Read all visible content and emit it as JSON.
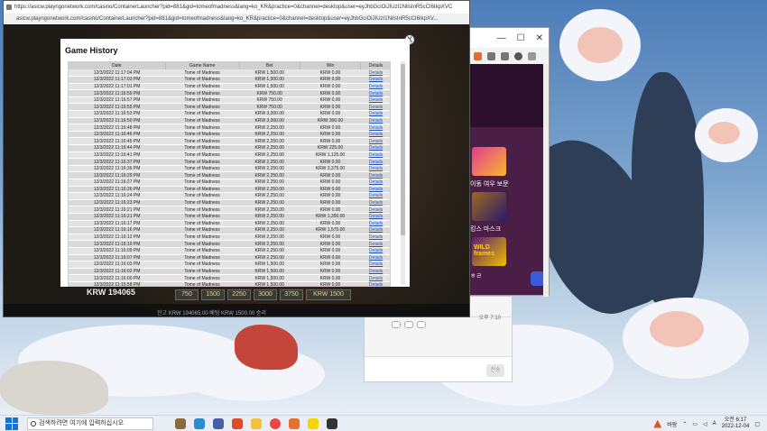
{
  "game_window": {
    "title": "https://asicw.playngonetwork.com/casino/ContainerLauncher?pid=881&gid=tomeofmadness&lang=ko_KR&practice=0&channel=desktop&user=eyJhbGciOiJIUzI1NiIsInR5cCI6IkpXVC",
    "url": "asicw.playngonetwork.com/casino/ContainerLauncher?pid=881&gid=tomeofmadness&lang=ko_KR&practice=0&channel=desktop&user=eyJhbGciOiJIUzI1NiIsInR5cCI6IkpXV...",
    "balance": "KRW 194065",
    "bet_options": [
      "750",
      "1500",
      "2250",
      "3000",
      "3750"
    ],
    "bet_display": "KRW 1500",
    "info_line": "잔고  KRW 194065.00     베팅  KRW 1500.00     승리",
    "close_symbol": "X"
  },
  "modal": {
    "title": "Game History",
    "columns": [
      "Date",
      "Game Name",
      "Bet",
      "Win",
      "Details"
    ],
    "rows": [
      [
        "12/3/2022 11:17:04 PM",
        "Tome of Madness",
        "KRW 1,500.00",
        "KRW 0.00",
        "Details"
      ],
      [
        "12/3/2022 11:17:03 PM",
        "Tome of Madness",
        "KRW 1,500.00",
        "KRW 0.00",
        "Details"
      ],
      [
        "12/3/2022 11:17:01 PM",
        "Tome of Madness",
        "KRW 1,500.00",
        "KRW 0.00",
        "Details"
      ],
      [
        "12/3/2022 11:16:59 PM",
        "Tome of Madness",
        "KRW 750.00",
        "KRW 0.00",
        "Details"
      ],
      [
        "12/3/2022 11:16:57 PM",
        "Tome of Madness",
        "KRW 750.00",
        "KRW 0.00",
        "Details"
      ],
      [
        "12/3/2022 11:16:55 PM",
        "Tome of Madness",
        "KRW 750.00",
        "KRW 0.00",
        "Details"
      ],
      [
        "12/3/2022 11:16:53 PM",
        "Tome of Madness",
        "KRW 3,000.00",
        "KRW 0.00",
        "Details"
      ],
      [
        "12/3/2022 11:16:50 PM",
        "Tome of Madness",
        "KRW 3,000.00",
        "KRW 300.00",
        "Details"
      ],
      [
        "12/3/2022 11:16:48 PM",
        "Tome of Madness",
        "KRW 2,250.00",
        "KRW 0.00",
        "Details"
      ],
      [
        "12/3/2022 11:16:46 PM",
        "Tome of Madness",
        "KRW 2,250.00",
        "KRW 0.00",
        "Details"
      ],
      [
        "12/3/2022 11:16:45 PM",
        "Tome of Madness",
        "KRW 2,250.00",
        "KRW 0.00",
        "Details"
      ],
      [
        "12/3/2022 11:16:44 PM",
        "Tome of Madness",
        "KRW 2,250.00",
        "KRW 225.00",
        "Details"
      ],
      [
        "12/3/2022 11:16:41 PM",
        "Tome of Madness",
        "KRW 2,250.00",
        "KRW 1,125.00",
        "Details"
      ],
      [
        "12/3/2022 11:16:37 PM",
        "Tome of Madness",
        "KRW 2,250.00",
        "KRW 0.00",
        "Details"
      ],
      [
        "12/3/2022 11:16:36 PM",
        "Tome of Madness",
        "KRW 2,250.00",
        "KRW 3,375.00",
        "Details"
      ],
      [
        "12/3/2022 11:16:29 PM",
        "Tome of Madness",
        "KRW 2,250.00",
        "KRW 0.00",
        "Details"
      ],
      [
        "12/3/2022 11:16:27 PM",
        "Tome of Madness",
        "KRW 2,250.00",
        "KRW 0.00",
        "Details"
      ],
      [
        "12/3/2022 11:16:26 PM",
        "Tome of Madness",
        "KRW 2,250.00",
        "KRW 0.00",
        "Details"
      ],
      [
        "12/3/2022 11:16:24 PM",
        "Tome of Madness",
        "KRW 2,250.00",
        "KRW 0.00",
        "Details"
      ],
      [
        "12/3/2022 11:16:23 PM",
        "Tome of Madness",
        "KRW 2,250.00",
        "KRW 0.00",
        "Details"
      ],
      [
        "12/3/2022 11:16:21 PM",
        "Tome of Madness",
        "KRW 2,250.00",
        "KRW 0.00",
        "Details"
      ],
      [
        "12/3/2022 11:16:21 PM",
        "Tome of Madness",
        "KRW 2,250.00",
        "KRW 1,350.00",
        "Details"
      ],
      [
        "12/3/2022 11:16:17 PM",
        "Tome of Madness",
        "KRW 2,250.00",
        "KRW 0.00",
        "Details"
      ],
      [
        "12/3/2022 11:16:16 PM",
        "Tome of Madness",
        "KRW 2,250.00",
        "KRW 1,575.00",
        "Details"
      ],
      [
        "12/3/2022 11:16:12 PM",
        "Tome of Madness",
        "KRW 2,250.00",
        "KRW 0.00",
        "Details"
      ],
      [
        "12/3/2022 11:16:10 PM",
        "Tome of Madness",
        "KRW 2,250.00",
        "KRW 0.00",
        "Details"
      ],
      [
        "12/3/2022 11:16:09 PM",
        "Tome of Madness",
        "KRW 2,250.00",
        "KRW 0.00",
        "Details"
      ],
      [
        "12/3/2022 11:16:07 PM",
        "Tome of Madness",
        "KRW 2,250.00",
        "KRW 0.00",
        "Details"
      ],
      [
        "12/3/2022 11:16:03 PM",
        "Tome of Madness",
        "KRW 1,500.00",
        "KRW 0.00",
        "Details"
      ],
      [
        "12/3/2022 11:16:02 PM",
        "Tome of Madness",
        "KRW 1,500.00",
        "KRW 0.00",
        "Details"
      ],
      [
        "12/3/2022 11:16:00 PM",
        "Tome of Madness",
        "KRW 1,500.00",
        "KRW 0.00",
        "Details"
      ],
      [
        "12/3/2022 11:15:58 PM",
        "Tome of Madness",
        "KRW 1,500.00",
        "KRW 0.00",
        "Details"
      ]
    ]
  },
  "side_browser": {
    "labels": [
      "이동 여우 보문",
      "킹스 마스크",
      "WILD frames",
      "ㅎㄹ"
    ]
  },
  "chat": {
    "time": "오후 7:10",
    "send": "전송"
  },
  "taskbar": {
    "search_placeholder": "검색하려면 여기에 입력하십시오",
    "weather": "바람",
    "ime": "A",
    "time": "오전 6:17",
    "date": "2022-12-04"
  },
  "colors": {
    "link": "#1a4fcc",
    "header_bg": "#d0d0d0",
    "game_bg": "#1e1a15"
  }
}
